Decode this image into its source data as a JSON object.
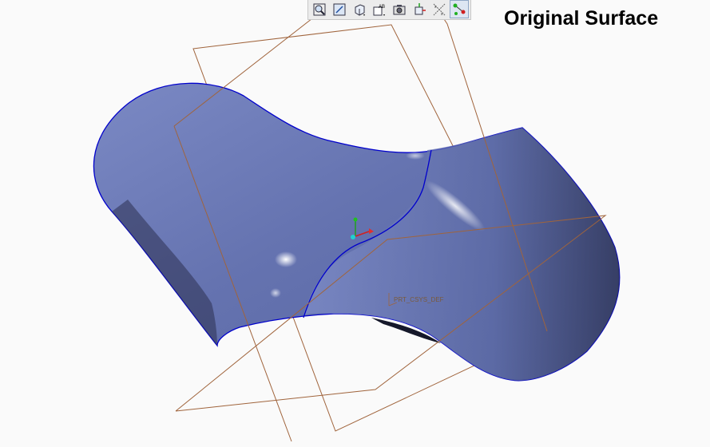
{
  "view": {
    "title": "Original Surface",
    "csys_label": "PRT_CSYS_DEF"
  },
  "toolbar": {
    "buttons": [
      {
        "name": "zoom-icon"
      },
      {
        "name": "refit-icon"
      },
      {
        "name": "view-orient-icon"
      },
      {
        "name": "saved-views-icon"
      },
      {
        "name": "camera-icon"
      },
      {
        "name": "spin-center-icon"
      },
      {
        "name": "datum-display-icon"
      },
      {
        "name": "sketch-display-icon",
        "active": true
      }
    ]
  },
  "colors": {
    "surface": "#6a79b8",
    "surface_edge": "#0000cc",
    "datum_plane": "#a0643c",
    "background": "#fafafa"
  }
}
